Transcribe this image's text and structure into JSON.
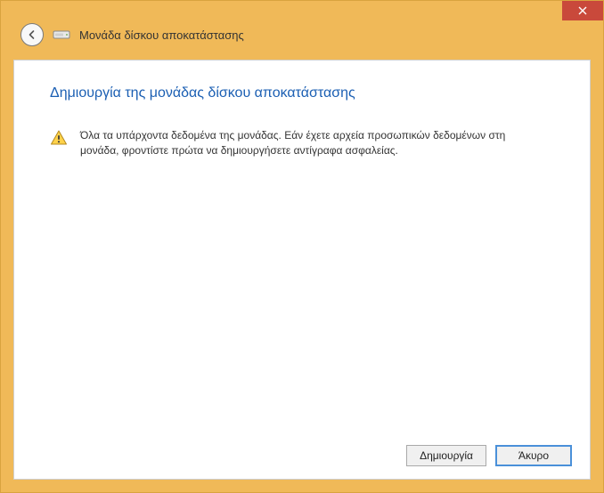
{
  "window": {
    "title": "Μονάδα δίσκου αποκατάστασης"
  },
  "content": {
    "heading": "Δημιουργία της μονάδας δίσκου αποκατάστασης",
    "warning": "Όλα τα υπάρχοντα δεδομένα της μονάδας. Εάν έχετε αρχεία προσωπικών δεδομένων στη μονάδα, φροντίστε πρώτα να δημιουργήσετε αντίγραφα ασφαλείας."
  },
  "footer": {
    "create_label": "Δημιουργία",
    "cancel_label": "Άκυρο"
  }
}
